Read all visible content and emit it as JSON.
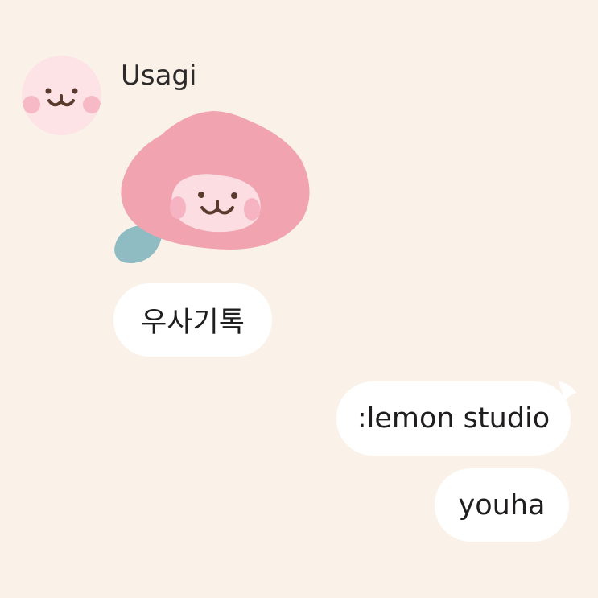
{
  "conversation": {
    "sender_name": "Usagi",
    "sender_avatar_icon": "bunny-face-icon",
    "sticker_icon": "peach-bunny-sticker",
    "incoming_messages": [
      {
        "text": "우사기톡"
      }
    ],
    "outgoing_messages": [
      {
        "text": ":lemon studio"
      },
      {
        "text": "youha"
      }
    ]
  },
  "colors": {
    "background": "#faf2e9",
    "bubble": "#ffffff",
    "peach": "#f2a3b0",
    "bunny_face": "#fcdde2",
    "cheek": "#f7b7c3",
    "leaf": "#8fbcc2",
    "face_lines": "#5b3a2e"
  }
}
